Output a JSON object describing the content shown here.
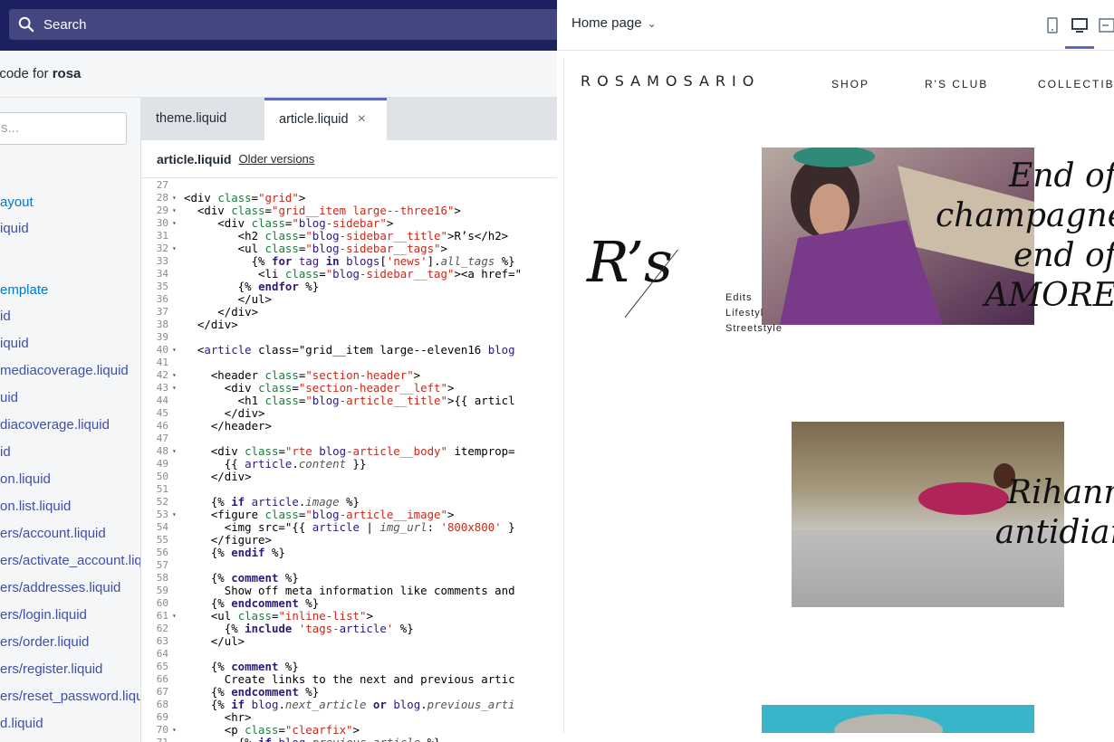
{
  "search": {
    "placeholder": "Search"
  },
  "page": {
    "title_prefix": "t code for ",
    "store": "rosa"
  },
  "sidebar": {
    "filter_placeholder": "s...",
    "items": [
      {
        "label": "ayout",
        "link": true
      },
      {
        "label": "iquid",
        "link": false
      },
      {
        "label": "emplate",
        "link": true
      },
      {
        "label": "id",
        "link": false
      },
      {
        "label": "iquid",
        "link": false
      },
      {
        "label": "mediacoverage.liquid",
        "link": false
      },
      {
        "label": "uid",
        "link": false
      },
      {
        "label": "diacoverage.liquid",
        "link": false
      },
      {
        "label": "id",
        "link": false
      },
      {
        "label": "on.liquid",
        "link": false
      },
      {
        "label": "on.list.liquid",
        "link": false
      },
      {
        "label": "ers/account.liquid",
        "link": false
      },
      {
        "label": "ers/activate_account.liq",
        "link": false
      },
      {
        "label": "ers/addresses.liquid",
        "link": false
      },
      {
        "label": "ers/login.liquid",
        "link": false
      },
      {
        "label": "ers/order.liquid",
        "link": false
      },
      {
        "label": "ers/register.liquid",
        "link": false
      },
      {
        "label": "ers/reset_password.liqu",
        "link": false
      },
      {
        "label": "d.liquid",
        "link": false
      }
    ]
  },
  "tabs": [
    {
      "label": "theme.liquid"
    },
    {
      "label": "article.liquid",
      "close": "×"
    }
  ],
  "file": {
    "name": "article.liquid",
    "older_versions": "Older versions"
  },
  "code": {
    "line_numbers": [
      "27",
      "28",
      "29",
      "30",
      "31",
      "32",
      "33",
      "34",
      "35",
      "36",
      "37",
      "38",
      "39",
      "40",
      "41",
      "42",
      "43",
      "44",
      "45",
      "46",
      "47",
      "48",
      "49",
      "50",
      "51",
      "52",
      "53",
      "54",
      "55",
      "56",
      "57",
      "58",
      "59",
      "60",
      "61",
      "62",
      "63",
      "64",
      "65",
      "66",
      "67",
      "68",
      "69",
      "70",
      "71"
    ],
    "fold_lines": [
      "28",
      "29",
      "30",
      "32",
      "40",
      "42",
      "43",
      "48",
      "53",
      "61",
      "70"
    ],
    "lines": [
      "",
      "<div class=\"grid\">",
      "  <div class=\"grid__item large--three16\">",
      "     <div class=\"blog-sidebar\">",
      "        <h2 class=\"blog-sidebar__title\">R’s</h2>",
      "        <ul class=\"blog-sidebar__tags\">",
      "          {% for tag in blogs['news'].all_tags %}",
      "           <li class=\"blog-sidebar__tag\"><a href=\"",
      "        {% endfor %}",
      "        </ul>",
      "     </div>",
      "  </div>",
      "",
      "  <article class=\"grid__item large--eleven16 blog",
      "",
      "    <header class=\"section-header\">",
      "      <div class=\"section-header__left\">",
      "        <h1 class=\"blog-article__title\">{{ articl",
      "      </div>",
      "    </header>",
      "",
      "    <div class=\"rte blog-article__body\" itemprop=",
      "      {{ article.content }}",
      "    </div>",
      "",
      "    {% if article.image %}",
      "    <figure class=\"blog-article__image\">",
      "      <img src=\"{{ article | img_url: '800x800' }",
      "    </figure>",
      "    {% endif %}",
      "",
      "    {% comment %}",
      "      Show off meta information like comments and",
      "    {% endcomment %}",
      "    <ul class=\"inline-list\">",
      "      {% include 'tags-article' %}",
      "    </ul>",
      "",
      "    {% comment %}",
      "      Create links to the next and previous artic",
      "    {% endcomment %}",
      "    {% if blog.next_article or blog.previous_arti",
      "      <hr>",
      "      <p class=\"clearfix\">",
      "        {% if blog.previous_article %}"
    ]
  },
  "preview": {
    "selector": "Home page",
    "logo": "ROSAMOSARIO",
    "nav": [
      "SHOP",
      "R'S CLUB",
      "COLLECTIBL"
    ],
    "heading": "R’s",
    "categories": [
      "Edits",
      "Lifestyl",
      "Streetstyle"
    ],
    "post1_title": [
      "End of",
      "champagne",
      "end of",
      "AMORE"
    ],
    "post2_title": [
      "Rihanna",
      "antidiary"
    ]
  },
  "colors": {
    "topbar": "#1c2260",
    "accent": "#5c6ac4",
    "link": "#007ace"
  }
}
